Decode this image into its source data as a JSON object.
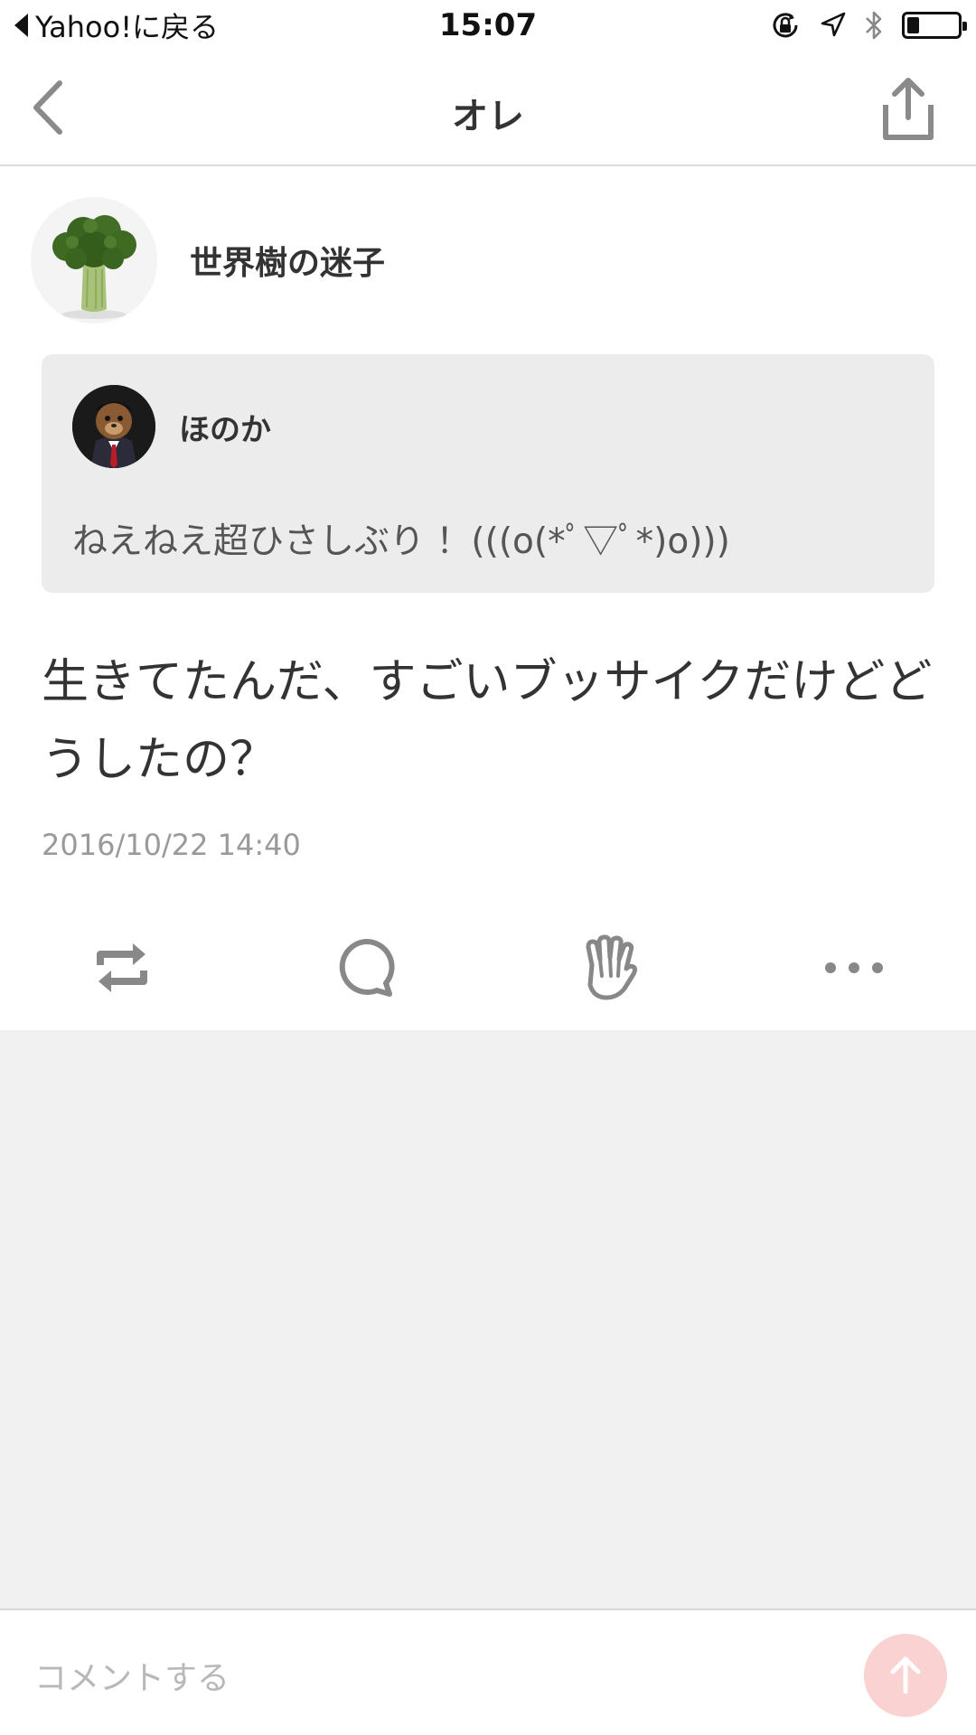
{
  "status_bar": {
    "back_label": "Yahoo!に戻る",
    "time": "15:07",
    "battery_level_fraction": 0.22,
    "icons": [
      "orientation-lock-icon",
      "location-icon",
      "bluetooth-icon",
      "battery-icon"
    ]
  },
  "nav": {
    "title": "オレ",
    "back_icon": "chevron-left-icon",
    "share_icon": "share-icon"
  },
  "author": {
    "name": "世界樹の迷子",
    "avatar": "broccoli-avatar"
  },
  "quoted_post": {
    "author_name": "ほのか",
    "text": "ねえねえ超ひさしぶり ！(((o(*ﾟ▽ﾟ*)o)))"
  },
  "post": {
    "text": "生きてたんだ、すごいブッサイクだけどどうしたの？",
    "timestamp": "2016/10/22 14:40"
  },
  "actions": {
    "icons": [
      "retweet-icon",
      "comment-icon",
      "clap-icon",
      "more-icon"
    ]
  },
  "comment_bar": {
    "placeholder": "コメントする",
    "send_icon": "arrow-up-icon"
  },
  "colors": {
    "icon_gray": "#888888",
    "send_button_bg": "#fbd2d2",
    "quote_bg": "#ececec",
    "empty_area_bg": "#f1f1f1"
  }
}
